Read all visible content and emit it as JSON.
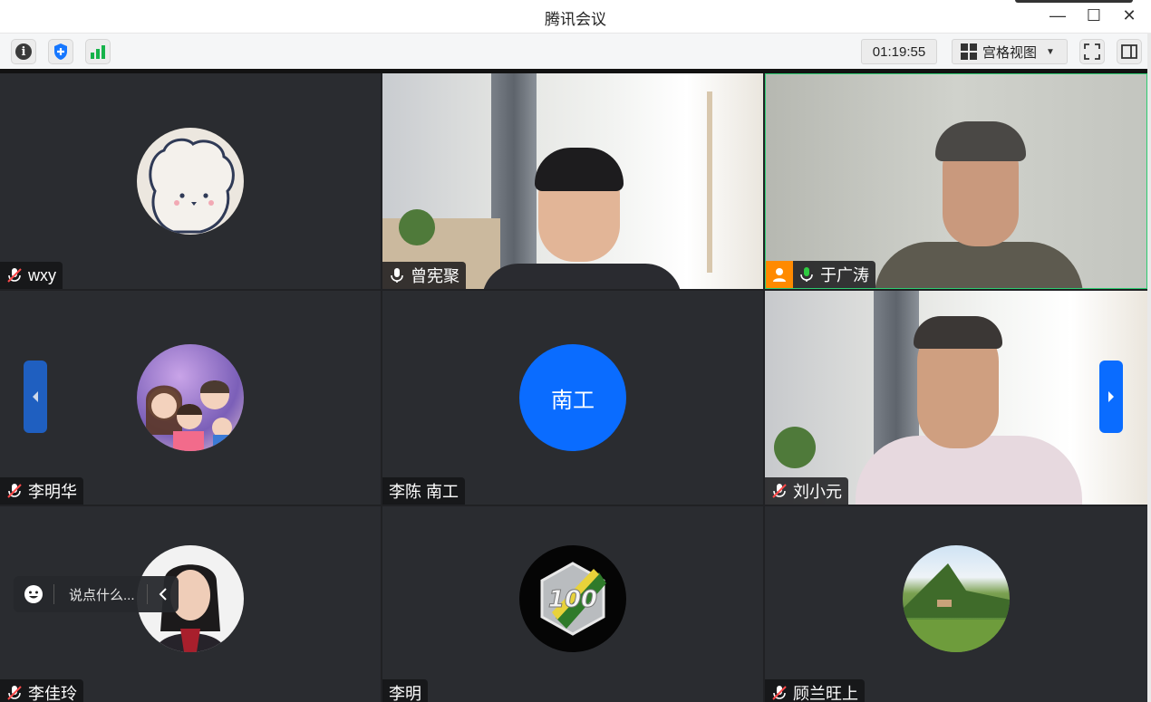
{
  "window": {
    "title": "腾讯会议",
    "controls": {
      "minimize": "—",
      "maximize": "☐",
      "close": "✕"
    }
  },
  "toolbar": {
    "timer": "01:19:55",
    "view_mode": "宫格视图",
    "icons": [
      "info-icon",
      "shield-icon",
      "signal-icon",
      "fullscreen-icon",
      "sidebar-icon"
    ]
  },
  "participants": [
    {
      "name": "wxy",
      "muted": true,
      "media": "avatar-bear"
    },
    {
      "name": "曾宪聚",
      "muted": false,
      "media": "video"
    },
    {
      "name": "于广涛",
      "muted": false,
      "media": "video",
      "host": true,
      "speaking": true
    },
    {
      "name": "李明华",
      "muted": true,
      "media": "avatar-family"
    },
    {
      "name": "李陈 南工",
      "muted": null,
      "media": "text-avatar",
      "avatar_text": "南工"
    },
    {
      "name": "刘小元",
      "muted": true,
      "media": "video"
    },
    {
      "name": "李佳玲",
      "muted": true,
      "media": "avatar-photo"
    },
    {
      "name": "李明",
      "muted": null,
      "media": "avatar-badge",
      "badge_text": "100"
    },
    {
      "name": "顾兰旺上",
      "muted": true,
      "media": "avatar-landscape"
    }
  ],
  "chat": {
    "placeholder": "说点什么..."
  },
  "colors": {
    "accent": "#0a6cff",
    "host": "#ff8a00",
    "stage": "#202124",
    "tile": "#2a2c30"
  }
}
